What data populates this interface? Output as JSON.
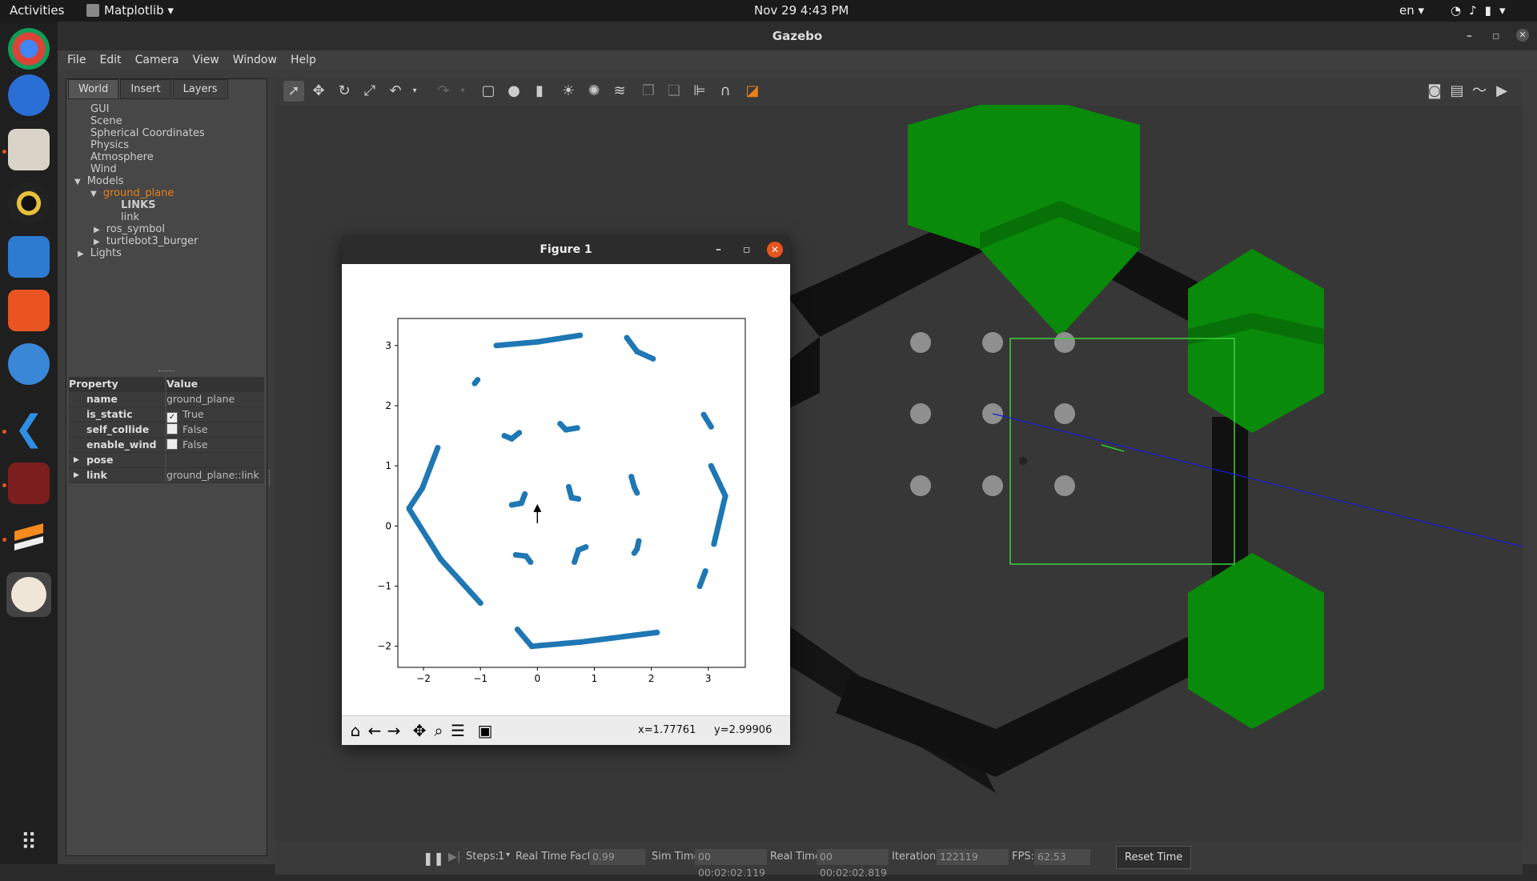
{
  "topbar": {
    "activities": "Activities",
    "app_menu": "Matplotlib ▾",
    "clock": "Nov 29  4:43 PM",
    "lang": "en ▾"
  },
  "dock": {
    "icons": [
      "chrome-icon",
      "thunderbird-icon",
      "files-icon",
      "rhythmbox-icon",
      "writer-icon",
      "app-store-icon",
      "help-icon",
      "vscode-icon",
      "terminal-icon",
      "sublime-icon",
      "gazebo-icon",
      "app-grid-icon"
    ]
  },
  "gazebo": {
    "title": "Gazebo",
    "menu": [
      "File",
      "Edit",
      "Camera",
      "View",
      "Window",
      "Help"
    ],
    "tabs": [
      "World",
      "Insert",
      "Layers"
    ],
    "tree": {
      "gui": "GUI",
      "scene": "Scene",
      "spherical": "Spherical Coordinates",
      "physics": "Physics",
      "atmosphere": "Atmosphere",
      "wind": "Wind",
      "models": "Models",
      "ground_plane": "ground_plane",
      "links_header": "LINKS",
      "link": "link",
      "ros_symbol": "ros_symbol",
      "turtlebot": "turtlebot3_burger",
      "lights": "Lights"
    },
    "props": {
      "header_key": "Property",
      "header_val": "Value",
      "rows": [
        {
          "k": "name",
          "v": "ground_plane"
        },
        {
          "k": "is_static",
          "v": "True"
        },
        {
          "k": "self_collide",
          "v": "False"
        },
        {
          "k": "enable_wind",
          "v": "False"
        },
        {
          "k": "pose",
          "v": ""
        },
        {
          "k": "link",
          "v": "ground_plane::link"
        }
      ]
    },
    "bottom": {
      "steps_label": "Steps:",
      "steps_val": "1",
      "rtf_label": "Real Time Factor:",
      "rtf_val": "0.99",
      "sim_label": "Sim Time:",
      "sim_val": "00 00:02:02.119",
      "real_label": "Real Time:",
      "real_val": "00 00:02:02.819",
      "iter_label": "Iterations:",
      "iter_val": "122119",
      "fps_label": "FPS:",
      "fps_val": "62.53",
      "reset": "Reset Time"
    }
  },
  "figure": {
    "title": "Figure 1",
    "coord_x": "x=1.77761",
    "coord_y": "y=2.99906"
  },
  "chart_data": {
    "type": "scatter",
    "title": "",
    "xlabel": "",
    "ylabel": "",
    "xlim": [
      -2.45,
      3.65
    ],
    "ylim": [
      -2.35,
      3.45
    ],
    "xticks": [
      -2,
      -1,
      0,
      1,
      2,
      3
    ],
    "yticks": [
      -2,
      -1,
      0,
      1,
      2,
      3
    ],
    "x_tick_labels": [
      "−2",
      "−1",
      "0",
      "1",
      "2",
      "3"
    ],
    "y_tick_labels": [
      "−2",
      "−1",
      "0",
      "1",
      "2",
      "3"
    ],
    "color": "#1f77b4",
    "arrow": {
      "x": 0.0,
      "y": 0.18,
      "direction": "up"
    },
    "segments": [
      {
        "name": "top-wall",
        "points": [
          [
            -0.72,
            3.0
          ],
          [
            0.0,
            3.06
          ],
          [
            0.75,
            3.17
          ]
        ]
      },
      {
        "name": "top-right",
        "points": [
          [
            1.57,
            3.13
          ],
          [
            1.75,
            2.9
          ],
          [
            2.03,
            2.78
          ]
        ]
      },
      {
        "name": "left-upper",
        "points": [
          [
            -1.75,
            1.3
          ],
          [
            -2.02,
            0.63
          ],
          [
            -2.25,
            0.3
          ]
        ]
      },
      {
        "name": "left-lower",
        "points": [
          [
            -2.25,
            0.28
          ],
          [
            -1.7,
            -0.55
          ],
          [
            -1.0,
            -1.28
          ]
        ]
      },
      {
        "name": "bottom-wall",
        "points": [
          [
            -0.35,
            -1.72
          ],
          [
            -0.1,
            -2.0
          ],
          [
            0.75,
            -1.93
          ],
          [
            2.1,
            -1.77
          ]
        ]
      },
      {
        "name": "right-upper",
        "points": [
          [
            3.05,
            1.0
          ],
          [
            3.3,
            0.5
          ],
          [
            3.1,
            -0.3
          ]
        ]
      },
      {
        "name": "right-top",
        "points": [
          [
            2.92,
            1.85
          ],
          [
            3.05,
            1.65
          ]
        ]
      },
      {
        "name": "right-bottom",
        "points": [
          [
            2.95,
            -0.75
          ],
          [
            2.85,
            -1.0
          ]
        ]
      },
      {
        "name": "blob-a",
        "points": [
          [
            -1.1,
            2.37
          ],
          [
            -1.05,
            2.43
          ]
        ]
      },
      {
        "name": "blob-b",
        "points": [
          [
            -0.58,
            1.5
          ],
          [
            -0.45,
            1.45
          ],
          [
            -0.32,
            1.55
          ]
        ]
      },
      {
        "name": "blob-c",
        "points": [
          [
            0.4,
            1.7
          ],
          [
            0.5,
            1.6
          ],
          [
            0.7,
            1.63
          ]
        ]
      },
      {
        "name": "blob-d",
        "points": [
          [
            -0.45,
            0.35
          ],
          [
            -0.28,
            0.38
          ],
          [
            -0.22,
            0.53
          ]
        ]
      },
      {
        "name": "blob-e",
        "points": [
          [
            0.55,
            0.65
          ],
          [
            0.6,
            0.47
          ],
          [
            0.72,
            0.45
          ]
        ]
      },
      {
        "name": "blob-f",
        "points": [
          [
            1.65,
            0.82
          ],
          [
            1.7,
            0.65
          ],
          [
            1.75,
            0.55
          ]
        ]
      },
      {
        "name": "blob-g",
        "points": [
          [
            -0.38,
            -0.48
          ],
          [
            -0.2,
            -0.5
          ],
          [
            -0.12,
            -0.6
          ]
        ]
      },
      {
        "name": "blob-h",
        "points": [
          [
            0.65,
            -0.6
          ],
          [
            0.72,
            -0.4
          ],
          [
            0.85,
            -0.35
          ]
        ]
      },
      {
        "name": "blob-i",
        "points": [
          [
            1.78,
            -0.25
          ],
          [
            1.75,
            -0.38
          ],
          [
            1.7,
            -0.45
          ]
        ]
      }
    ]
  }
}
